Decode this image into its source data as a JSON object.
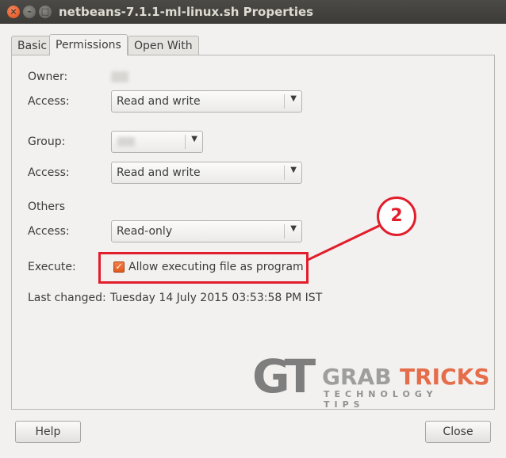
{
  "window": {
    "title": "netbeans-7.1.1-ml-linux.sh Properties",
    "close_glyph": "×",
    "min_glyph": "–",
    "max_glyph": "□"
  },
  "tabs": [
    {
      "label": "Basic",
      "active": false
    },
    {
      "label": "Permissions",
      "active": true
    },
    {
      "label": "Open With",
      "active": false
    }
  ],
  "permissions": {
    "owner_label": "Owner:",
    "owner_access_label": "Access:",
    "owner_access_value": "Read and write",
    "group_label": "Group:",
    "group_access_label": "Access:",
    "group_access_value": "Read and write",
    "others_label": "Others",
    "others_access_label": "Access:",
    "others_access_value": "Read-only",
    "execute_label": "Execute:",
    "execute_checkbox_label": "Allow executing file as program",
    "execute_checked": true,
    "last_changed_label": "Last changed:",
    "last_changed_value": "Tuesday 14 July 2015 03:53:58 PM IST"
  },
  "annotation": {
    "callout_number": "2",
    "color": "#e21e2c"
  },
  "watermark": {
    "logo_mark": "GT",
    "brand_a": "GRAB",
    "brand_b": "TRICKS",
    "tagline": "TECHNOLOGY TIPS"
  },
  "footer": {
    "help_label": "Help",
    "close_label": "Close"
  },
  "icons": {
    "dropdown": "chevron-down-icon",
    "check": "check-icon"
  }
}
